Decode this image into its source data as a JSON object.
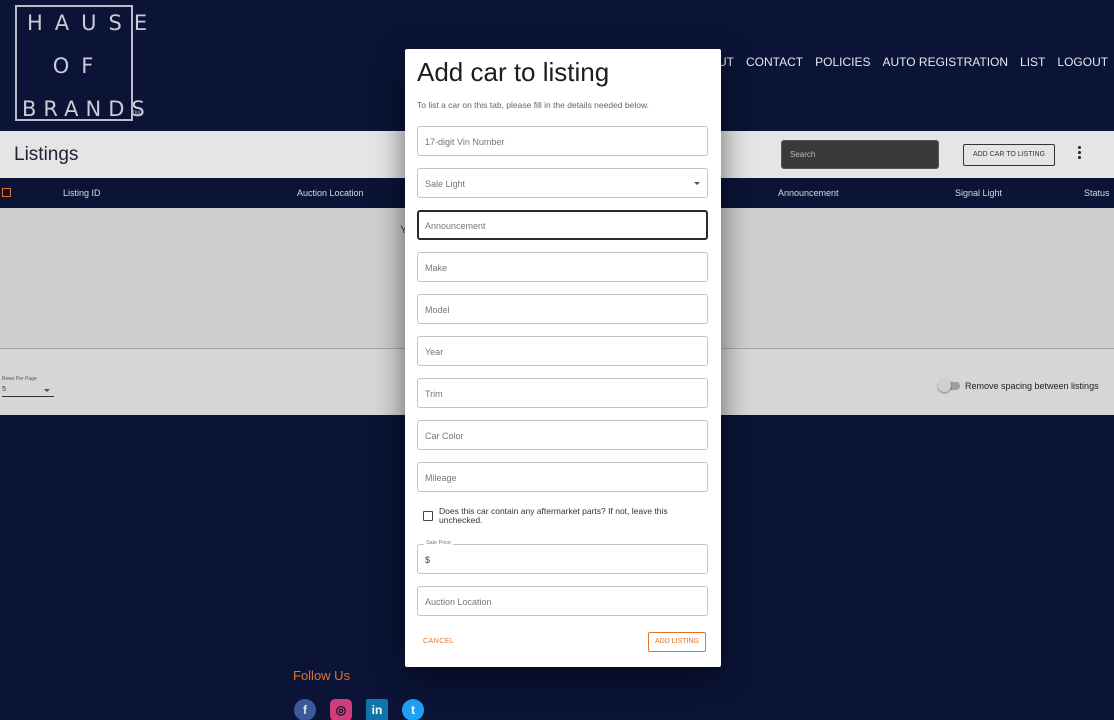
{
  "logo": {
    "line1": "HAUSE",
    "line2": "OF",
    "line3": "BRANDS",
    "tm": "TM"
  },
  "nav": [
    "UT",
    "CONTACT",
    "POLICIES",
    "AUTO REGISTRATION",
    "LIST",
    "LOGOUT"
  ],
  "listings": {
    "title": "Listings",
    "search_placeholder": "Search",
    "add_button": "ADD CAR TO LISTING",
    "columns": [
      "Listing ID",
      "Auction Location",
      "Announcement",
      "Signal Light",
      "Status"
    ],
    "empty_hint_left": "Y",
    "empty_hint_right": "."
  },
  "table_footer": {
    "rows_per_page_label": "Rows Per Page",
    "rows_per_page_value": "5",
    "spacing_toggle_label": "Remove spacing between listings"
  },
  "follow": {
    "title": "Follow Us",
    "icons": [
      "facebook-icon",
      "instagram-icon",
      "linkedin-icon",
      "twitter-icon"
    ],
    "glyphs": {
      "facebook": "f",
      "instagram": "◎",
      "linkedin": "in",
      "twitter": "t"
    }
  },
  "modal": {
    "title": "Add car to listing",
    "subtitle": "To list a car on this tab, please fill in the details needed below.",
    "fields": {
      "vin": "17-digit Vin Number",
      "sale_light": "Sale Light",
      "announcement": "Announcement",
      "make": "Make",
      "model": "Model",
      "year": "Year",
      "trim": "Trim",
      "color": "Car Color",
      "mileage": "Mileage",
      "sale_price_label": "Sale Price",
      "sale_price_value": "$",
      "auction_location": "Auction Location"
    },
    "aftermarket_label": "Does this car contain any aftermarket parts? If not, leave this unchecked.",
    "cancel": "CANCEL",
    "submit": "ADD LISTING"
  },
  "colors": {
    "navy": "#0b1437",
    "accent": "#e2732a"
  }
}
